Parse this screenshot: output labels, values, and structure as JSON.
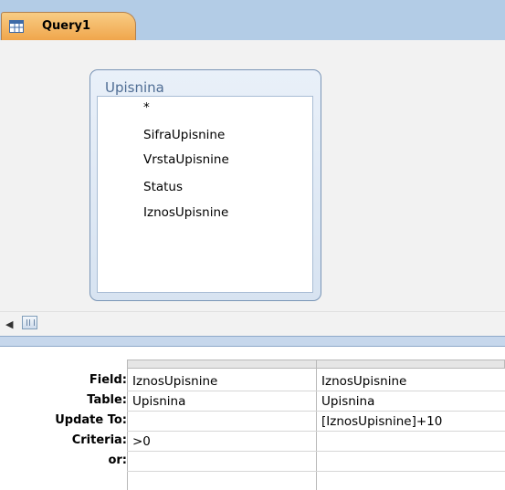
{
  "tab": {
    "label": "Query1",
    "icon": "query-icon"
  },
  "table": {
    "title": "Upisnina",
    "fields": [
      "*",
      "SifraUpisnine",
      "VrstaUpisnine",
      "Status",
      "IznosUpisnine"
    ]
  },
  "grid": {
    "row_labels": {
      "field": "Field:",
      "table": "Table:",
      "update_to": "Update To:",
      "criteria": "Criteria:",
      "or": "or:"
    },
    "columns": [
      {
        "field": "IznosUpisnine",
        "table": "Upisnina",
        "update_to": "",
        "criteria": ">0"
      },
      {
        "field": "IznosUpisnine",
        "table": "Upisnina",
        "update_to": "[IznosUpisnine]+10",
        "criteria": ""
      }
    ]
  }
}
